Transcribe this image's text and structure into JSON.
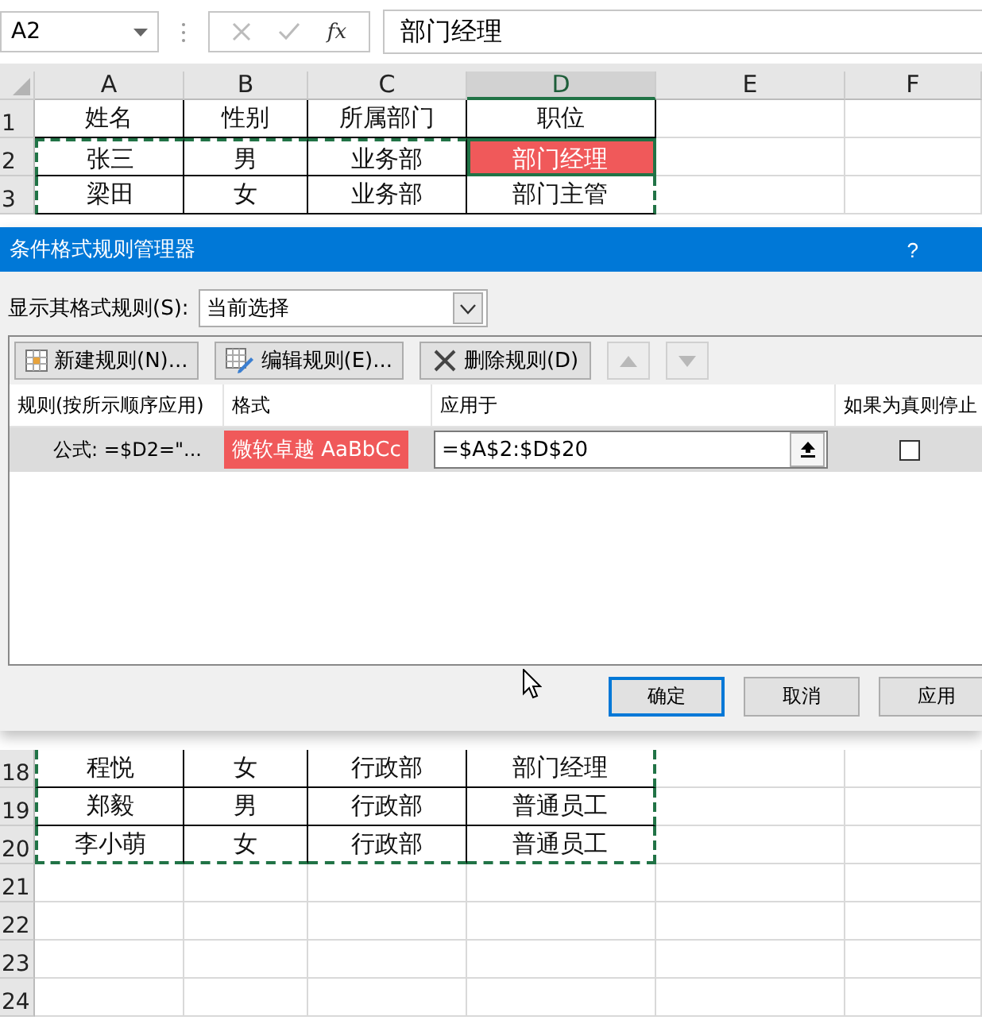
{
  "name_box": "A2",
  "formula_bar": {
    "value": "部门经理",
    "fx": "fx"
  },
  "sheet": {
    "columns": [
      {
        "label": "A",
        "selected": false
      },
      {
        "label": "B",
        "selected": false
      },
      {
        "label": "C",
        "selected": false
      },
      {
        "label": "D",
        "selected": true
      },
      {
        "label": "E",
        "selected": false
      },
      {
        "label": "F",
        "selected": false
      }
    ],
    "rows_top": [
      {
        "header": "1",
        "marquee": false,
        "cells": [
          {
            "text": "姓名",
            "highlighted": false
          },
          {
            "text": "性别",
            "highlighted": false
          },
          {
            "text": "所属部门",
            "highlighted": false
          },
          {
            "text": "职位",
            "highlighted": false
          }
        ]
      },
      {
        "header": "2",
        "marquee": true,
        "cells": [
          {
            "text": "张三",
            "highlighted": false
          },
          {
            "text": "男",
            "highlighted": false
          },
          {
            "text": "业务部",
            "highlighted": false
          },
          {
            "text": "部门经理",
            "highlighted": true
          }
        ]
      },
      {
        "header": "3",
        "marquee": true,
        "cells": [
          {
            "text": "梁田",
            "highlighted": false
          },
          {
            "text": "女",
            "highlighted": false
          },
          {
            "text": "业务部",
            "highlighted": false
          },
          {
            "text": "部门主管",
            "highlighted": false
          }
        ]
      }
    ],
    "rows_bottom": [
      {
        "header": "18",
        "marquee": true,
        "cells": [
          {
            "text": "程悦",
            "highlighted": false
          },
          {
            "text": "女",
            "highlighted": false
          },
          {
            "text": "行政部",
            "highlighted": false
          },
          {
            "text": "部门经理",
            "highlighted": false
          }
        ]
      },
      {
        "header": "19",
        "marquee": true,
        "cells": [
          {
            "text": "郑毅",
            "highlighted": false
          },
          {
            "text": "男",
            "highlighted": false
          },
          {
            "text": "行政部",
            "highlighted": false
          },
          {
            "text": "普通员工",
            "highlighted": false
          }
        ]
      },
      {
        "header": "20",
        "marquee": true,
        "cells": [
          {
            "text": "李小萌",
            "highlighted": false
          },
          {
            "text": "女",
            "highlighted": false
          },
          {
            "text": "行政部",
            "highlighted": false
          },
          {
            "text": "普通员工",
            "highlighted": false
          }
        ]
      },
      {
        "header": "21"
      },
      {
        "header": "22"
      },
      {
        "header": "23"
      },
      {
        "header": "24"
      }
    ]
  },
  "dialog": {
    "title": "条件格式规则管理器",
    "help": "?",
    "show_rules_label": "显示其格式规则(S):",
    "show_rules_value": "当前选择",
    "toolbar": [
      {
        "kind": "new",
        "label": "新建规则(N)...",
        "disabled": false
      },
      {
        "kind": "edit",
        "label": "编辑规则(E)...",
        "disabled": false
      },
      {
        "kind": "delete",
        "label": "删除规则(D)",
        "disabled": false
      },
      {
        "kind": "up",
        "disabled": true
      },
      {
        "kind": "down",
        "disabled": true
      }
    ],
    "columns": [
      "规则(按所示顺序应用)",
      "格式",
      "应用于",
      "如果为真则停止"
    ],
    "rules": [
      {
        "condition": "公式: =$D2=\"...",
        "format_preview": "微软卓越  AaBbCc",
        "applies_to": "=$A$2:$D$20",
        "stop_if_true": false,
        "selected": true
      }
    ],
    "buttons": [
      {
        "label": "确定",
        "default": true
      },
      {
        "label": "取消",
        "default": false
      },
      {
        "label": "应用",
        "default": false
      }
    ]
  }
}
